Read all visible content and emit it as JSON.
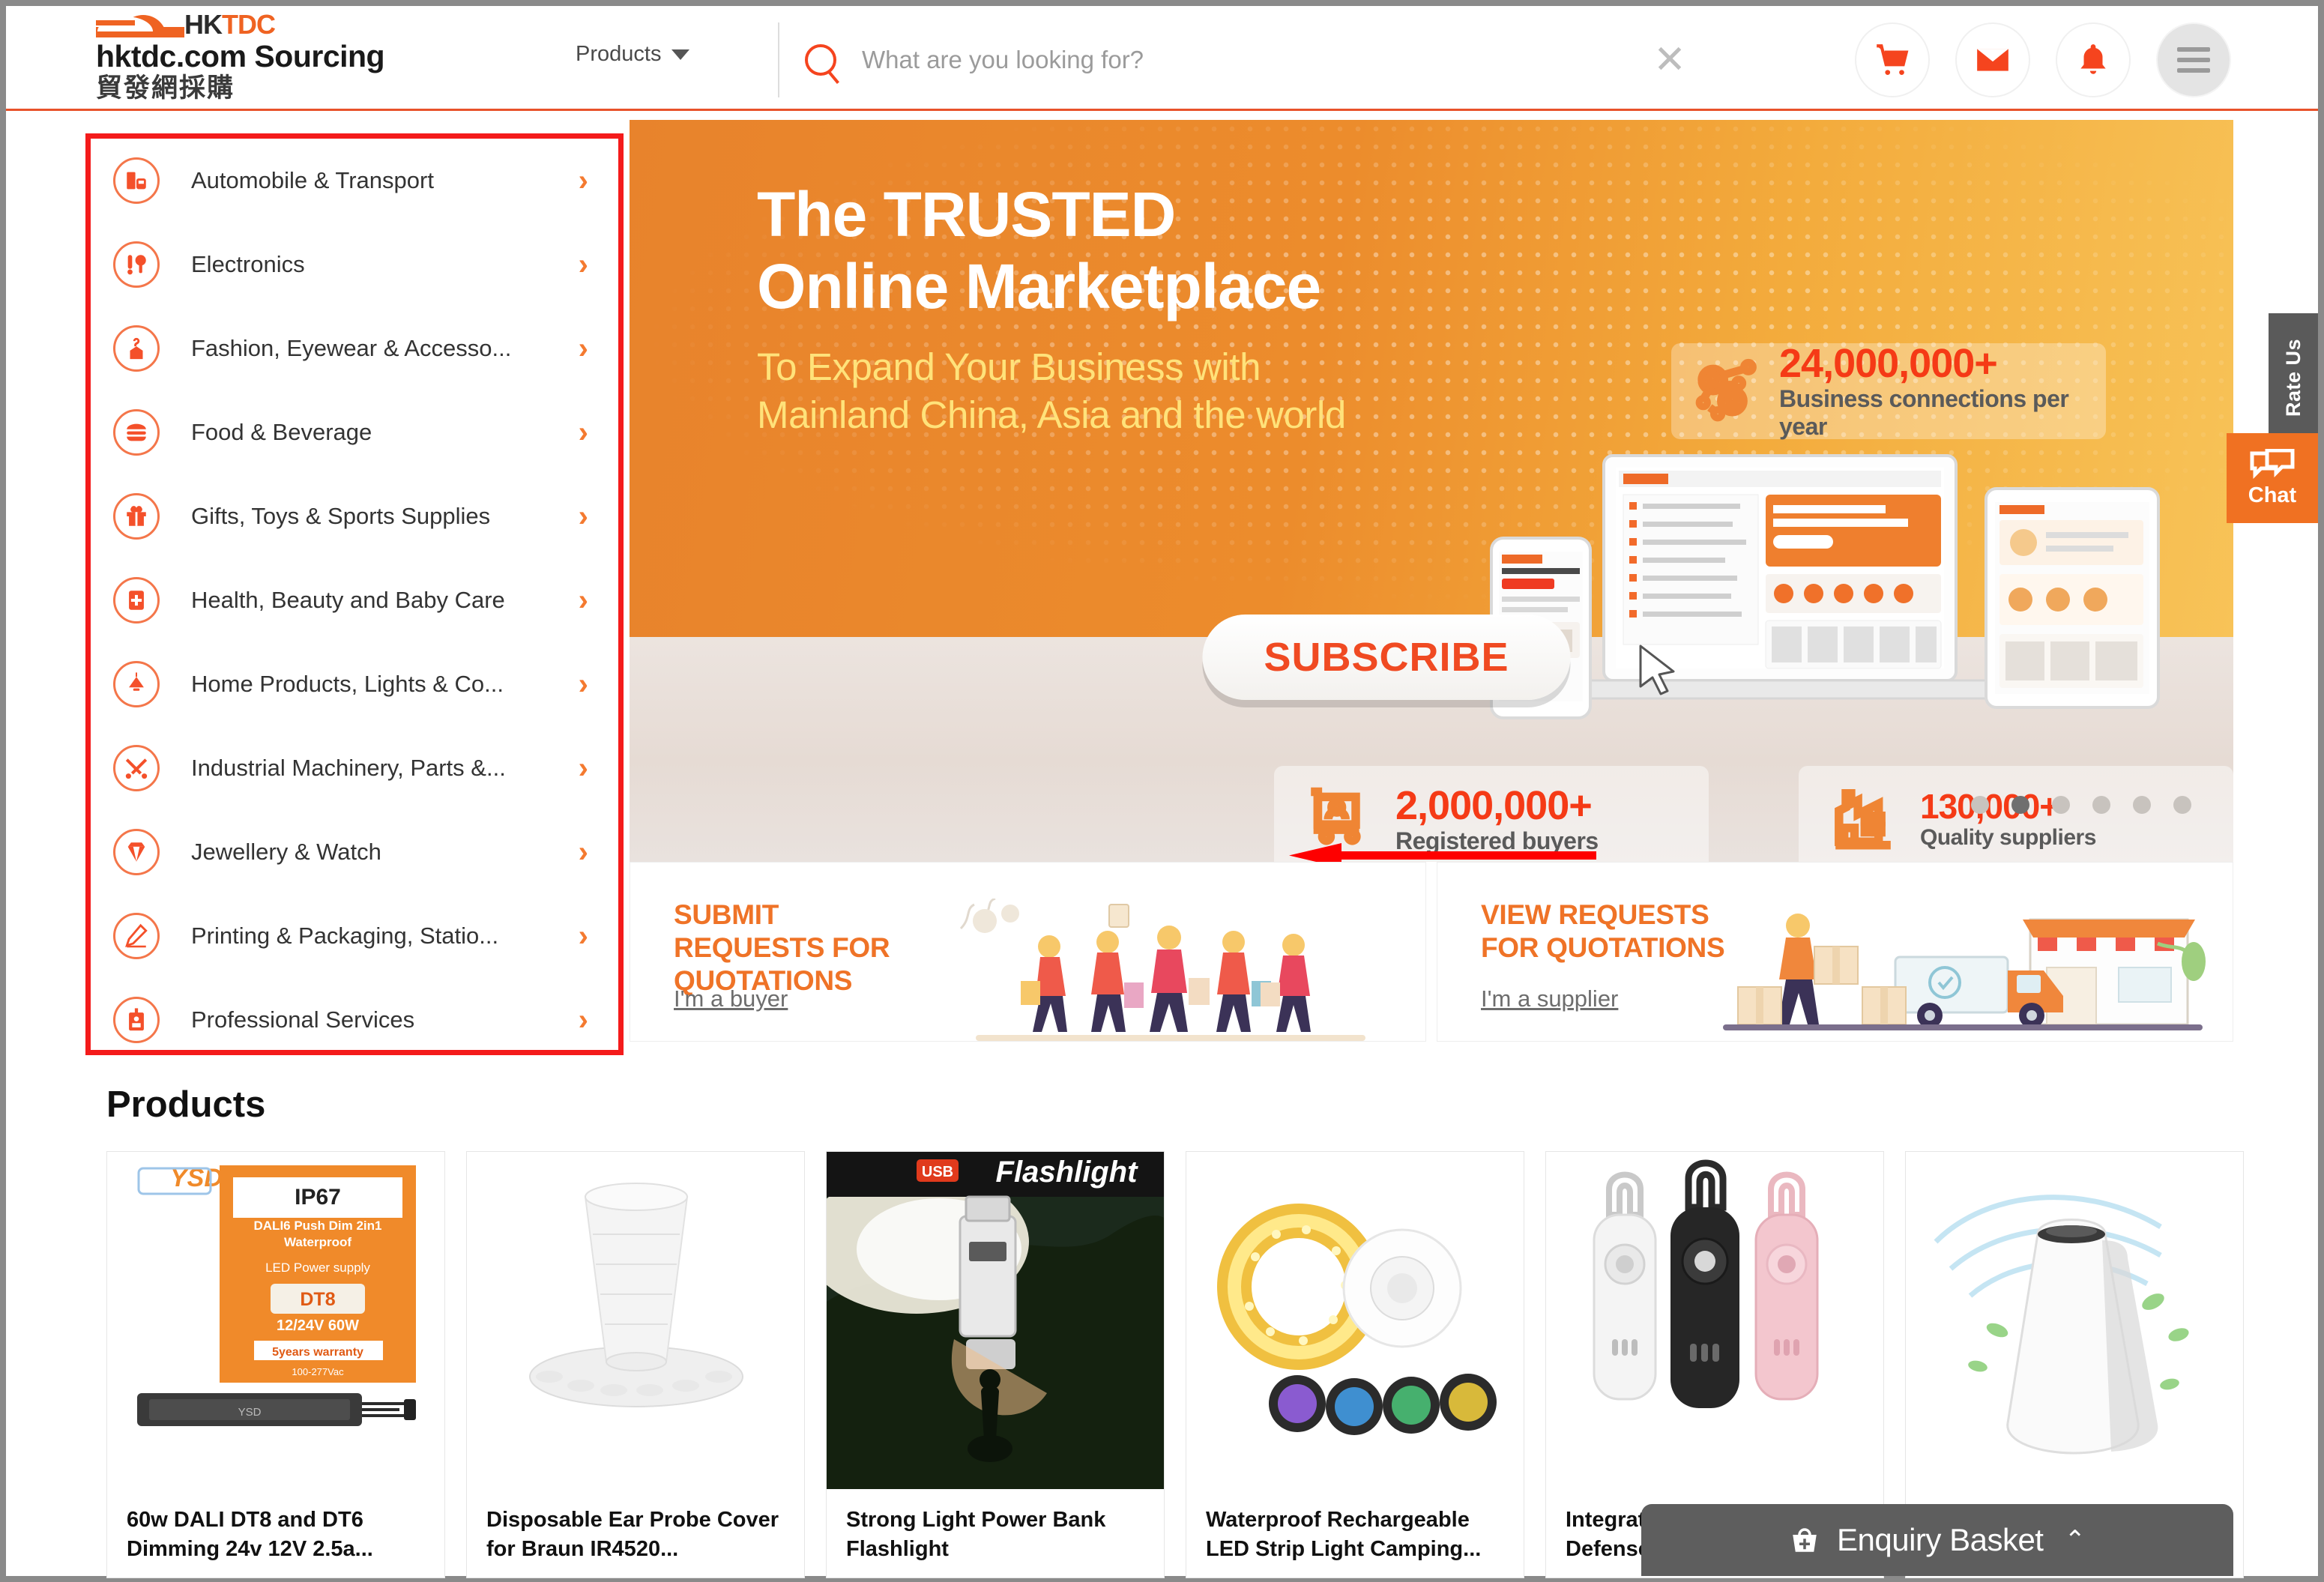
{
  "header": {
    "logo": {
      "mark_text_hk": "HK",
      "mark_text_td": "TD",
      "mark_text_c": "C",
      "title": "hktdc.com Sourcing",
      "subtitle": "貿發網採購"
    },
    "products_dropdown": "Products",
    "search": {
      "placeholder": "What are you looking for?",
      "value": "",
      "clear": "✕"
    },
    "icons": [
      {
        "name": "cart-icon",
        "label": "Shopping Cart"
      },
      {
        "name": "mail-icon",
        "label": "Messages"
      },
      {
        "name": "bell-icon",
        "label": "Notifications"
      },
      {
        "name": "menu-icon",
        "label": "Menu"
      }
    ]
  },
  "categories": [
    {
      "label": "Automobile & Transport",
      "icon": "car-icon"
    },
    {
      "label": "Electronics",
      "icon": "electronics-icon"
    },
    {
      "label": "Fashion, Eyewear & Accesso...",
      "icon": "hanger-icon"
    },
    {
      "label": "Food & Beverage",
      "icon": "burger-icon"
    },
    {
      "label": "Gifts, Toys & Sports Supplies",
      "icon": "gift-icon"
    },
    {
      "label": "Health, Beauty and Baby Care",
      "icon": "health-icon"
    },
    {
      "label": "Home Products, Lights & Co...",
      "icon": "lamp-icon"
    },
    {
      "label": "Industrial Machinery, Parts &...",
      "icon": "tools-icon"
    },
    {
      "label": "Jewellery & Watch",
      "icon": "gem-icon"
    },
    {
      "label": "Printing & Packaging, Statio...",
      "icon": "pen-icon"
    },
    {
      "label": "Professional Services",
      "icon": "badge-icon"
    }
  ],
  "hero": {
    "headline_line1": "The TRUSTED",
    "headline_line2": "Online Marketplace",
    "sub_line1": "To Expand Your Business with",
    "sub_line2": "Mainland China, Asia and the world",
    "cta": "SUBSCRIBE",
    "stats": [
      {
        "number": "24,000,000+",
        "label": "Business connections per year",
        "icon": "network-icon"
      },
      {
        "number": "2,000,000+",
        "label": "Registered buyers",
        "icon": "buyer-cart-icon"
      },
      {
        "number": "130,000+",
        "label": "Quality suppliers",
        "icon": "factory-icon"
      }
    ],
    "carousel": {
      "count": 6,
      "active_index": 1
    }
  },
  "rfq": [
    {
      "title_line1": "SUBMIT",
      "title_line2": "REQUESTS FOR",
      "title_line3": "QUOTATIONS",
      "link": "I'm a buyer"
    },
    {
      "title_line1": "VIEW REQUESTS",
      "title_line2": "FOR QUOTATIONS",
      "title_line3": "",
      "link": "I'm a supplier"
    }
  ],
  "products_section": {
    "title": "Products",
    "items": [
      {
        "name": "60w DALI DT8 and DT6 Dimming 24v 12V 2.5a...",
        "image": "led-driver"
      },
      {
        "name": "Disposable Ear Probe Cover for Braun IR4520...",
        "image": "ear-probe-cover"
      },
      {
        "name": "Strong Light Power Bank Flashlight",
        "image": "flashlight",
        "badge": "USB Flashlight"
      },
      {
        "name": "Waterproof Rechargeable LED Strip Light Camping...",
        "image": "led-strip-light"
      },
      {
        "name": "Integrated Personal Defense...",
        "image": "personal-alarm"
      },
      {
        "name": "",
        "image": "air-purifier"
      }
    ]
  },
  "side_tabs": {
    "rate_us": "Rate Us",
    "chat": "Chat"
  },
  "enquiry_basket": {
    "label": "Enquiry Basket",
    "chevron": "⌃"
  },
  "colors": {
    "brand_orange": "#ef6322",
    "accent_red": "#f5441e",
    "highlight_red": "#f41b1b",
    "hero_yellow": "#ffe27a"
  }
}
